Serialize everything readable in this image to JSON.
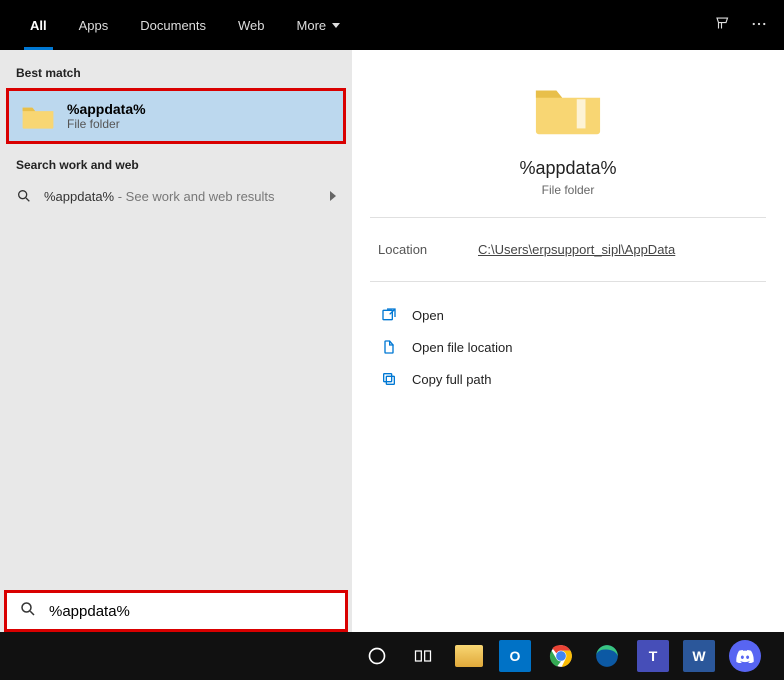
{
  "topbar": {
    "tabs": [
      {
        "label": "All",
        "active": true
      },
      {
        "label": "Apps"
      },
      {
        "label": "Documents"
      },
      {
        "label": "Web"
      },
      {
        "label": "More",
        "dropdown": true
      }
    ]
  },
  "left": {
    "best_match_header": "Best match",
    "best_match": {
      "title": "%appdata%",
      "subtitle": "File folder"
    },
    "search_section_header": "Search work and web",
    "search_result": {
      "query": "%appdata%",
      "suffix": " - See work and web results"
    }
  },
  "preview": {
    "title": "%appdata%",
    "subtitle": "File folder",
    "location_label": "Location",
    "location_value": "C:\\Users\\erpsupport_sipl\\AppData",
    "actions": {
      "open": "Open",
      "open_location": "Open file location",
      "copy_path": "Copy full path"
    }
  },
  "search_input": {
    "value": "%appdata%"
  },
  "colors": {
    "accent": "#0078d4",
    "highlight_border": "#d90000"
  }
}
